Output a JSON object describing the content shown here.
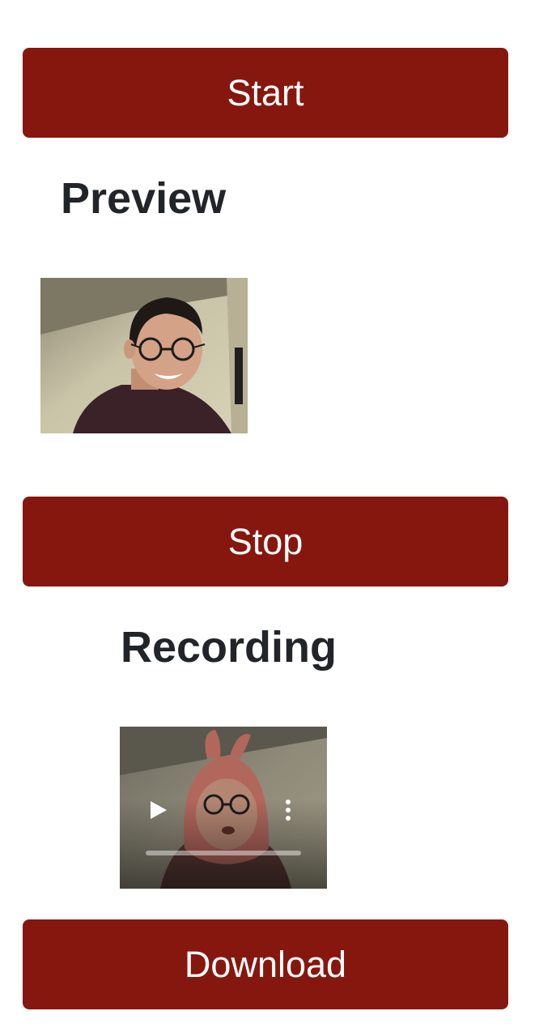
{
  "buttons": {
    "start": "Start",
    "stop": "Stop",
    "download": "Download"
  },
  "sections": {
    "preview_title": "Preview",
    "recording_title": "Recording"
  },
  "recording_player": {
    "progress": 0
  },
  "colors": {
    "button_bg": "#86170f",
    "button_text": "#ffffff",
    "heading_text": "#212529"
  },
  "icons": {
    "play": "play-icon",
    "more": "more-vertical-icon"
  }
}
